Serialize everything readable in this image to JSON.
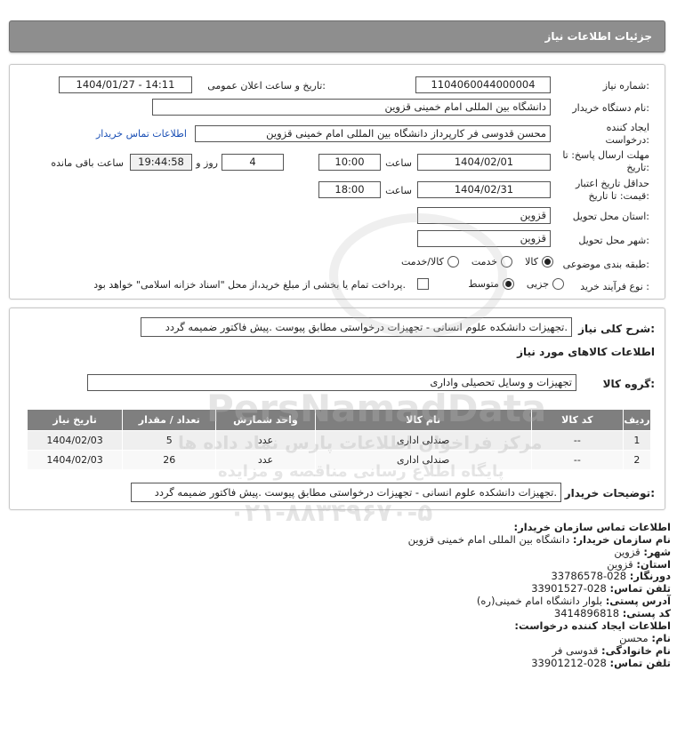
{
  "header": {
    "title": "جزئیات اطلاعات نیاز"
  },
  "form": {
    "need_number_label": "شماره نیاز:",
    "need_number": "1104060044000004",
    "announce_label": "تاریخ و ساعت اعلان عمومی:",
    "announce_value": "1404/01/27 - 14:11",
    "buyer_org_label": "نام دستگاه خریدار:",
    "buyer_org": "دانشگاه بین المللی امام خمینی قزوین",
    "requester_label": "ایجاد کننده درخواست:",
    "requester": "محسن قدوسی فر کارپرداز دانشگاه بین المللی امام خمینی قزوین",
    "contact_link": "اطلاعات تماس خریدار",
    "deadline_label": "مهلت ارسال پاسخ: تا تاریخ:",
    "deadline_date": "1404/02/01",
    "time_label": "ساعت",
    "deadline_time": "10:00",
    "days_value": "4",
    "days_label": "روز و",
    "remaining_time": "19:44:58",
    "remaining_label": "ساعت باقی مانده",
    "validity_label": "حداقل تاریخ اعتبار قیمت: تا تاریخ:",
    "validity_date": "1404/02/31",
    "validity_time": "18:00",
    "province_label": "استان محل تحویل:",
    "province": "قزوین",
    "city_label": "شهر محل تحویل:",
    "city": "قزوین",
    "category_label": "طبقه بندی موضوعی:",
    "category_options": [
      "کالا",
      "خدمت",
      "کالا/خدمت"
    ],
    "category_selected": "کالا",
    "process_label": "نوع فرآیند خرید :",
    "process_options": [
      "جزیی",
      "متوسط"
    ],
    "process_selected": "متوسط",
    "payment_note": "پرداخت تمام یا بخشی از مبلغ خرید،از محل \"اسناد خزانه اسلامی\" خواهد بود."
  },
  "summary": {
    "label": "شرح کلی نیاز:",
    "text": "تجهیزات دانشکده علوم انسانی - تجهیزات درخواستی مطابق پیوست .پیش فاکتور ضمیمه گردد.",
    "goods_info_title": "اطلاعات کالاهای مورد نیاز",
    "group_label": "گروه کالا:",
    "group_value": "تجهیزات و وسایل تحصیلی واداری"
  },
  "table": {
    "headers": [
      "ردیف",
      "کد کالا",
      "نام کالا",
      "واحد شمارش",
      "تعداد / مقدار",
      "تاریخ نیاز"
    ],
    "rows": [
      [
        "1",
        "--",
        "صندلی اداری",
        "عدد",
        "5",
        "1404/02/03"
      ],
      [
        "2",
        "--",
        "صندلی اداری",
        "عدد",
        "26",
        "1404/02/03"
      ]
    ]
  },
  "buyer_notes": {
    "label": "توضیحات خریدار:",
    "text": "تجهیزات دانشکده علوم انسانی - تجهیزات درخواستی مطابق پیوست .پیش فاکتور ضمیمه گردد."
  },
  "contact": {
    "title": "اطلاعات تماس سازمان خریدار:",
    "org_label": "نام سازمان خریدار:",
    "org": "دانشگاه بین المللی امام خمینی قزوین",
    "city_label": "شهر:",
    "city": "قزوین",
    "province_label": "استان:",
    "province": "قزوین",
    "fax_label": "دورنگار:",
    "fax": "028-33786578",
    "phone_label": "تلفن تماس:",
    "phone": "028-33901527",
    "address_label": "آدرس پستی:",
    "address": "بلوار دانشگاه امام خمینی(ره)",
    "postal_label": "کد پستی:",
    "postal": "3414896818",
    "creator_title": "اطلاعات ایجاد کننده درخواست:",
    "name_label": "نام:",
    "name": "محسن",
    "family_label": "نام خانوادگی:",
    "family": "قدوسی فر",
    "creator_phone_label": "تلفن تماس:",
    "creator_phone": "028-33901212"
  },
  "watermark": {
    "line1": "PersNamadData",
    "line2": "مرکز فراخوان اطلاعات پارس نماد داده ها",
    "line3": "پایگاه اطلاع رسانی مناقصه و مزایده",
    "phone": "۰۲۱-۸۸۳۴۹۶۷۰-۵"
  }
}
